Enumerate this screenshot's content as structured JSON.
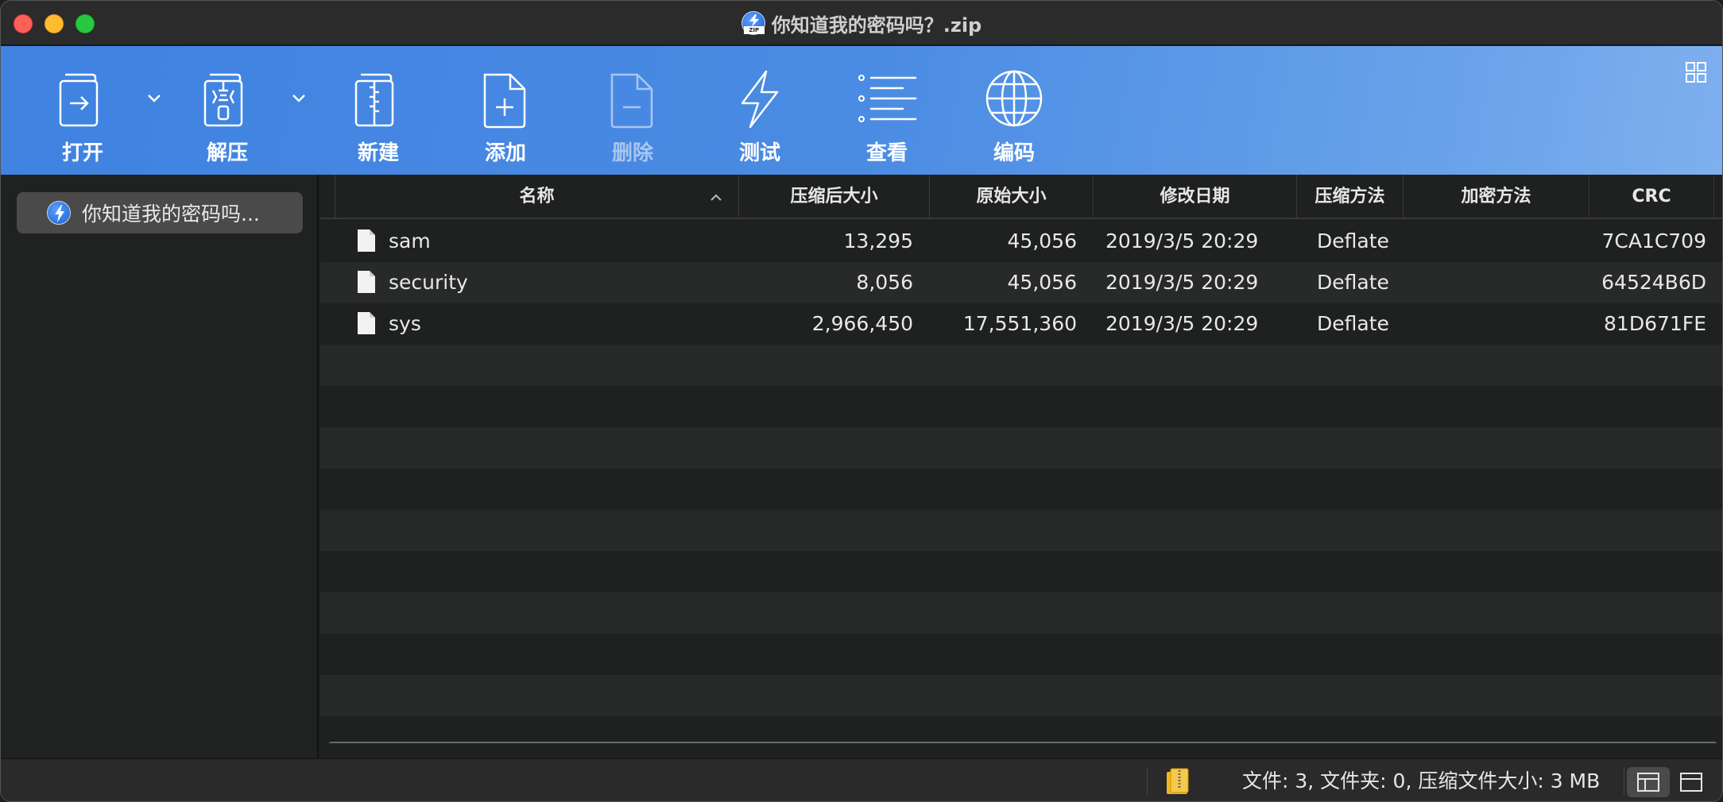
{
  "window": {
    "title": "你知道我的密码吗？.zip",
    "app_icon_text": "ZIP"
  },
  "toolbar": {
    "items": [
      {
        "label": "打开",
        "icon": "open-icon",
        "enabled": true,
        "has_dropdown": true
      },
      {
        "label": "解压",
        "icon": "extract-icon",
        "enabled": true,
        "has_dropdown": true
      },
      {
        "label": "新建",
        "icon": "new-archive-icon",
        "enabled": true,
        "has_dropdown": false
      },
      {
        "label": "添加",
        "icon": "add-file-icon",
        "enabled": true,
        "has_dropdown": false
      },
      {
        "label": "删除",
        "icon": "delete-file-icon",
        "enabled": false,
        "has_dropdown": false
      },
      {
        "label": "测试",
        "icon": "lightning-icon",
        "enabled": true,
        "has_dropdown": false
      },
      {
        "label": "查看",
        "icon": "list-view-icon",
        "enabled": true,
        "has_dropdown": false
      },
      {
        "label": "编码",
        "icon": "globe-icon",
        "enabled": true,
        "has_dropdown": false
      }
    ]
  },
  "sidebar": {
    "items": [
      {
        "label": "你知道我的密码吗...",
        "selected": true
      }
    ]
  },
  "table": {
    "columns": [
      "名称",
      "压缩后大小",
      "原始大小",
      "修改日期",
      "压缩方法",
      "加密方法",
      "CRC"
    ],
    "sort_column": "名称",
    "sort_direction": "ascending",
    "rows": [
      {
        "name": "sam",
        "compressed": "13,295",
        "original": "45,056",
        "modified": "2019/3/5 20:29",
        "method": "Deflate",
        "encryption": "",
        "crc": "7CA1C709"
      },
      {
        "name": "security",
        "compressed": "8,056",
        "original": "45,056",
        "modified": "2019/3/5 20:29",
        "method": "Deflate",
        "encryption": "",
        "crc": "64524B6D"
      },
      {
        "name": "sys",
        "compressed": "2,966,450",
        "original": "17,551,360",
        "modified": "2019/3/5 20:29",
        "method": "Deflate",
        "encryption": "",
        "crc": "81D671FE"
      }
    ]
  },
  "status": {
    "text": "文件: 3, 文件夹: 0, 压缩文件大小: 3 MB"
  },
  "colors": {
    "toolbar_start": "#3f82e0",
    "toolbar_end": "#7eb0ee",
    "traffic_close": "#fe5f57",
    "traffic_min": "#febc2e",
    "traffic_max": "#28c840"
  }
}
